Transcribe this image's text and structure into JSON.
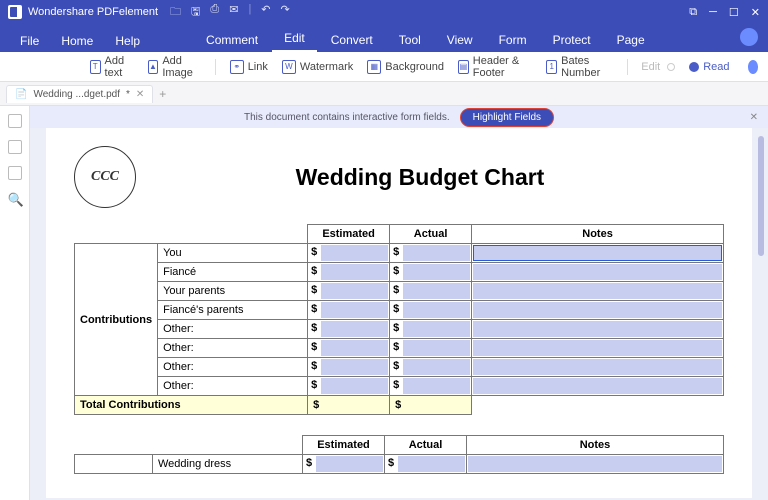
{
  "app": {
    "name": "Wondershare PDFelement"
  },
  "menu_top": [
    "File",
    "Home",
    "Help"
  ],
  "menu_main": [
    "Comment",
    "Edit",
    "Convert",
    "Tool",
    "View",
    "Form",
    "Protect",
    "Page"
  ],
  "menu_active": "Edit",
  "toolbar": {
    "add_text": "Add text",
    "add_image": "Add Image",
    "link": "Link",
    "watermark": "Watermark",
    "background": "Background",
    "header_footer": "Header & Footer",
    "bates": "Bates Number",
    "edit": "Edit",
    "read": "Read"
  },
  "tab": {
    "name": "Wedding ...dget.pdf",
    "mark": "*"
  },
  "notice": {
    "text": "This document contains interactive form fields.",
    "button": "Highlight Fields"
  },
  "doc": {
    "title": "Wedding Budget Chart",
    "cols": [
      "Estimated",
      "Actual",
      "Notes"
    ],
    "section1": "Contributions",
    "rows1": [
      "You",
      "Fiancé",
      "Your parents",
      "Fiancé's parents",
      "Other:",
      "Other:",
      "Other:",
      "Other:"
    ],
    "total1": "Total Contributions",
    "currency": "$",
    "rows2": [
      "Wedding dress"
    ]
  }
}
